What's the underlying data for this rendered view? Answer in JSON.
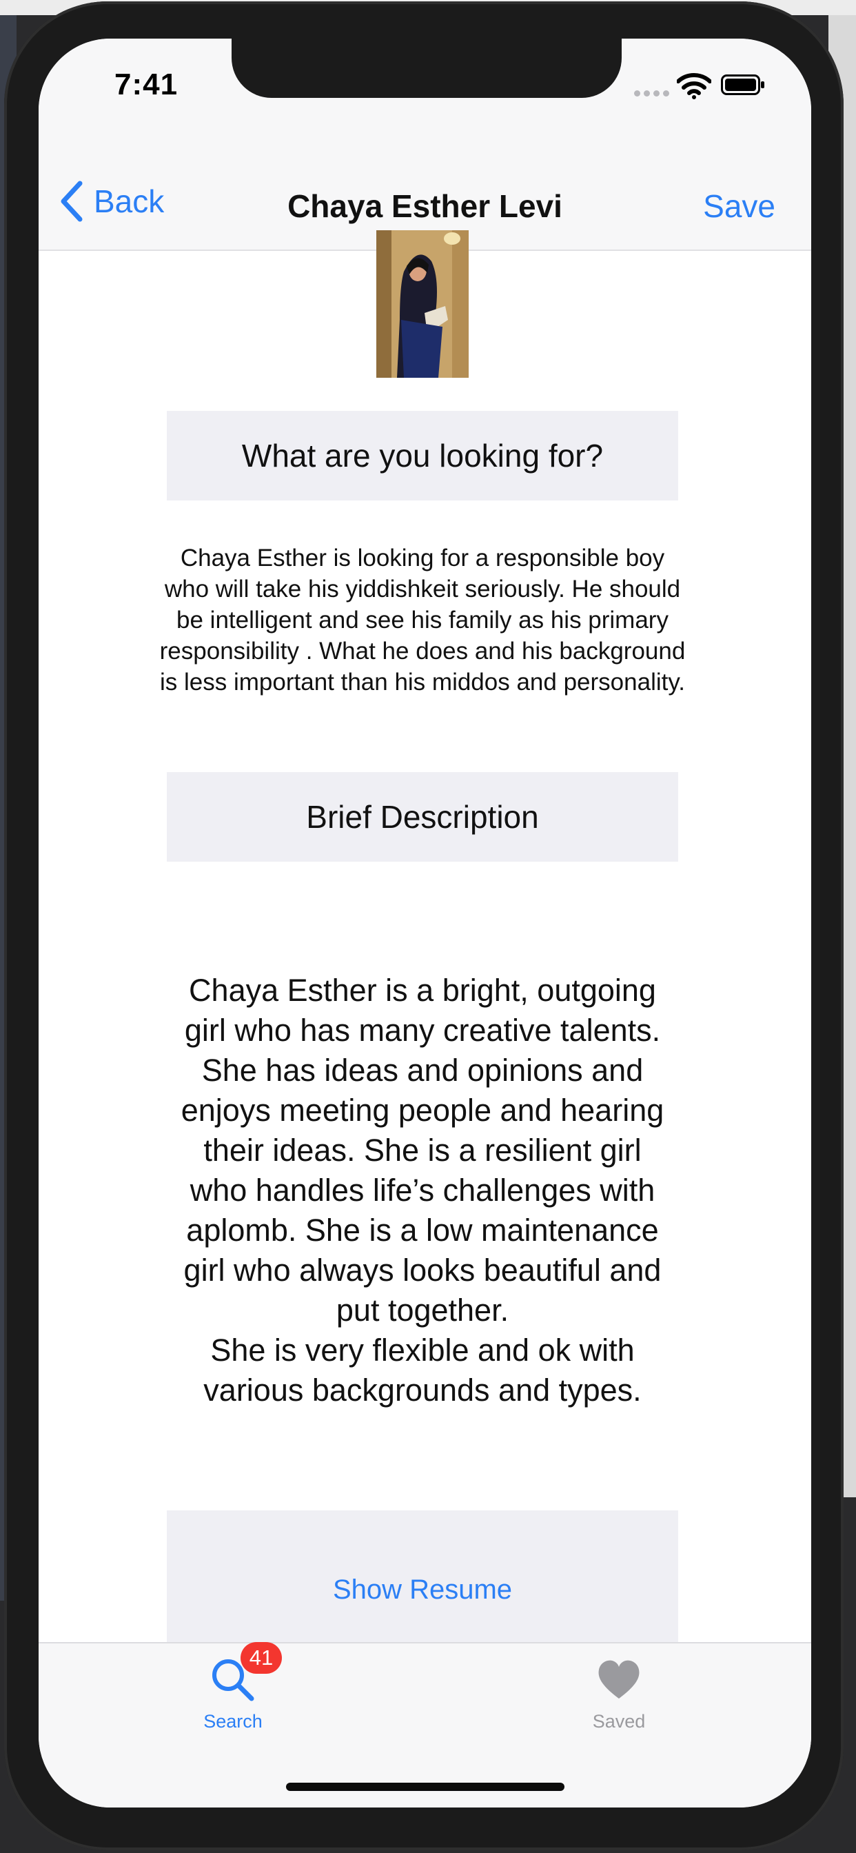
{
  "status": {
    "time": "7:41"
  },
  "nav": {
    "back_label": "Back",
    "title": "Chaya Esther Levi",
    "save_label": "Save"
  },
  "profile": {
    "photo_icon": "profile-photo"
  },
  "looking_for": {
    "heading": "What are you looking for?",
    "text": "Chaya Esther is looking for a responsible boy who will take his yiddishkeit seriously. He should be intelligent and see his family as his primary responsibility . What he does and his background is less important than his middos and personality."
  },
  "description": {
    "heading": "Brief Description",
    "lines": [
      "Chaya Esther is a bright, outgoing",
      "girl who has many creative  talents.",
      "She has ideas and opinions and",
      "enjoys meeting people and hearing",
      "their ideas. She is a resilient girl",
      "who handles life’s challenges with",
      "aplomb. She is a low maintenance",
      "girl who always looks beautiful and",
      "put together.",
      "She is very flexible and ok with",
      "various backgrounds and types."
    ]
  },
  "resume": {
    "button_label": "Show Resume"
  },
  "tabbar": {
    "search": {
      "label": "Search",
      "badge": "41",
      "icon": "search-icon"
    },
    "saved": {
      "label": "Saved",
      "icon": "heart-icon"
    }
  },
  "colors": {
    "accent": "#2b7ff5",
    "badge": "#f3362f",
    "section_bg": "#efeff4"
  }
}
